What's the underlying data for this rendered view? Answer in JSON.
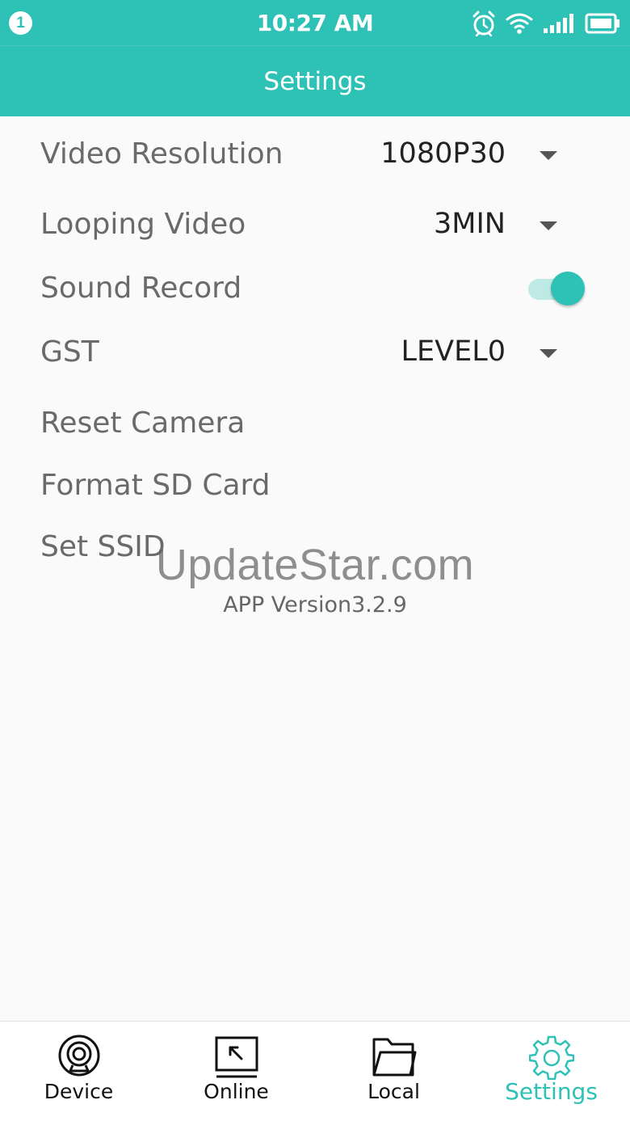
{
  "status_bar": {
    "notification_count": "1",
    "time": "10:27 AM",
    "icons": [
      "alarm-icon",
      "wifi-icon",
      "signal-icon",
      "battery-icon"
    ]
  },
  "app_bar": {
    "title": "Settings"
  },
  "settings": {
    "video_resolution": {
      "label": "Video Resolution",
      "value": "1080P30"
    },
    "looping_video": {
      "label": "Looping Video",
      "value": "3MIN"
    },
    "sound_record": {
      "label": "Sound Record",
      "enabled": true
    },
    "gst": {
      "label": "GST",
      "value": "LEVEL0"
    },
    "reset_camera": {
      "label": "Reset Camera"
    },
    "format_sd_card": {
      "label": "Format SD Card"
    },
    "set_ssid": {
      "label": "Set SSID"
    }
  },
  "watermark": "UpdateStar.com",
  "app_version": "APP Version3.2.9",
  "bottom_nav": {
    "items": [
      {
        "label": "Device",
        "icon": "webcam-icon",
        "active": false
      },
      {
        "label": "Online",
        "icon": "online-icon",
        "active": false
      },
      {
        "label": "Local",
        "icon": "folder-icon",
        "active": false
      },
      {
        "label": "Settings",
        "icon": "gear-icon",
        "active": true
      }
    ]
  },
  "colors": {
    "accent": "#2ec1b6",
    "background": "#fafafa",
    "toggle_track": "#bfe9e4"
  }
}
